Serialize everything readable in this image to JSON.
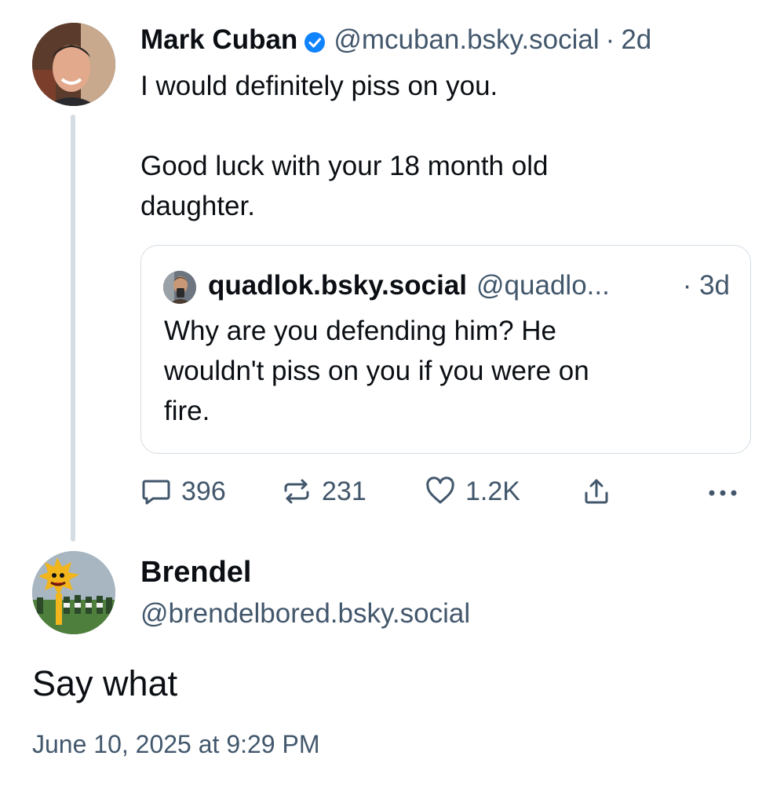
{
  "parent_post": {
    "display_name": "Mark Cuban",
    "verified": true,
    "handle": "@mcuban.bsky.social",
    "separator": "·",
    "age": "2d",
    "text_lines": [
      "I would definitely piss on you.",
      "Good luck with your 18 month old",
      "daughter."
    ],
    "avatar_icon": "person-avatar"
  },
  "quoted_post": {
    "display_name": "quadlok.bsky.social",
    "handle": "@quadlo...",
    "age": "· 3d",
    "text_lines": [
      "Why are you defending him? He",
      "wouldn't piss on you if you were on",
      "fire."
    ],
    "avatar_icon": "person-avatar"
  },
  "actions": {
    "reply_count": "396",
    "repost_count": "231",
    "like_count": "1.2K",
    "reply_icon": "speech-bubble-icon",
    "repost_icon": "repost-arrows-icon",
    "like_icon": "heart-icon",
    "share_icon": "share-icon",
    "more_icon": "ellipsis-icon"
  },
  "reply_post": {
    "display_name": "Brendel",
    "handle": "@brendelbored.bsky.social",
    "text": "Say what",
    "timestamp": "June 10, 2025 at 9:29 PM",
    "avatar_icon": "mascot-avatar"
  },
  "colors": {
    "text_primary": "#0b0f14",
    "text_secondary": "#42576c",
    "verified_blue": "#1083fe",
    "border": "#d4dce3",
    "thread_line": "#d5dde4"
  }
}
